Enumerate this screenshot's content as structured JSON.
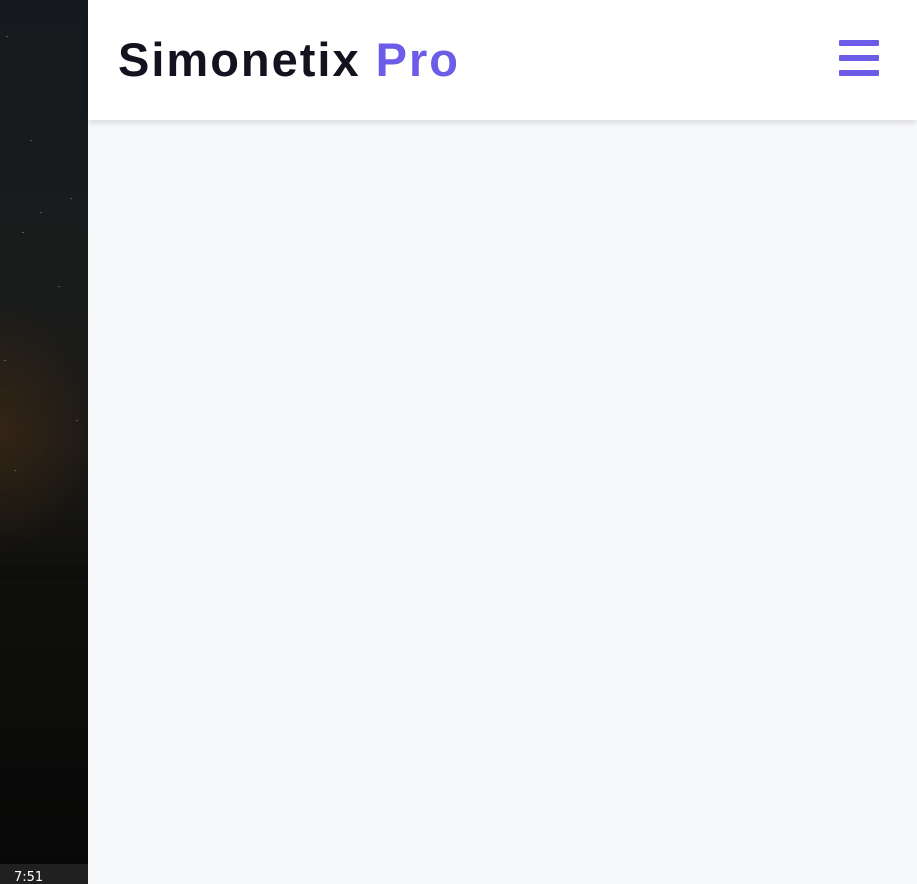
{
  "taskbar": {
    "clock": "7:51"
  },
  "app": {
    "brand": {
      "name": "Simonetix",
      "accent": "Pro"
    },
    "menu_icon": "hamburger-menu-icon",
    "colors": {
      "accent": "#6c5ce7",
      "brand_text": "#13121f",
      "header_bg": "#ffffff",
      "page_bg": "#f8f9fb"
    }
  }
}
